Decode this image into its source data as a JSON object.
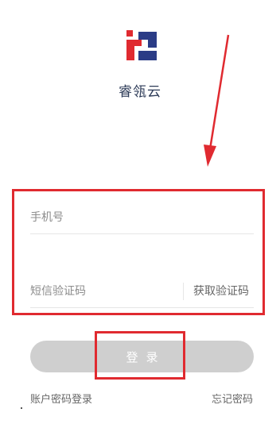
{
  "brand": {
    "app_name": "睿瓴云",
    "logo_colors": {
      "red": "#e02a30",
      "blue": "#2b3c86"
    }
  },
  "annotation": {
    "color": "#e02a30"
  },
  "login_form": {
    "phone_placeholder": "手机号",
    "sms_code_placeholder": "短信验证码",
    "get_code_label": "获取验证码",
    "login_button_label": "登录"
  },
  "links": {
    "account_password_login": "账户密码登录",
    "forgot_password": "忘记密码"
  }
}
